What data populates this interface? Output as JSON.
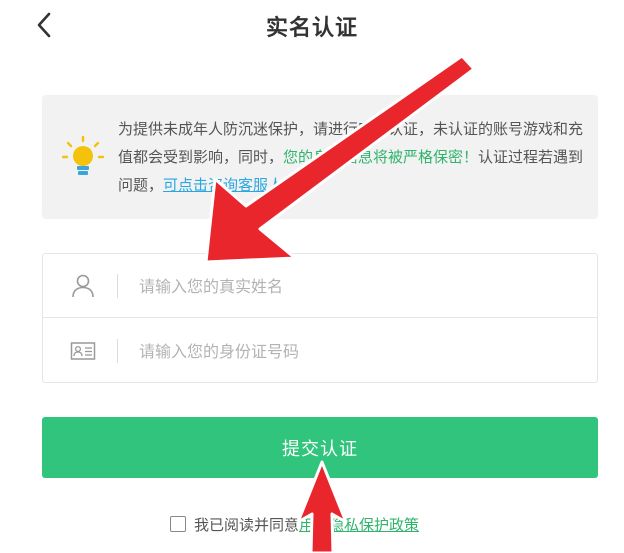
{
  "header": {
    "title": "实名认证",
    "back_icon": "chevron-left-icon"
  },
  "notice": {
    "icon": "lightbulb-icon",
    "text_part1": "为提供未成年人防沉迷保护，请进行实名认证，未认证的账号游戏和充值都会受到影响，同时，",
    "text_green": "您的身份信息将被严格保密！",
    "text_part2": "认证过程若遇到问题，",
    "link": "可点击咨询客服人员",
    "green_color": "#2fb46c",
    "link_color": "#2aa7e0"
  },
  "form": {
    "name_field": {
      "icon": "user-icon",
      "placeholder": "请输入您的真实姓名",
      "value": ""
    },
    "id_field": {
      "icon": "id-card-icon",
      "placeholder": "请输入您的身份证号码",
      "value": ""
    }
  },
  "submit": {
    "label": "提交认证",
    "color": "#31c47c"
  },
  "agreement": {
    "checked": false,
    "text": "我已阅读并同意",
    "link": "用户隐私保护政策"
  },
  "annotations": {
    "arrow_color": "#e8262b"
  }
}
